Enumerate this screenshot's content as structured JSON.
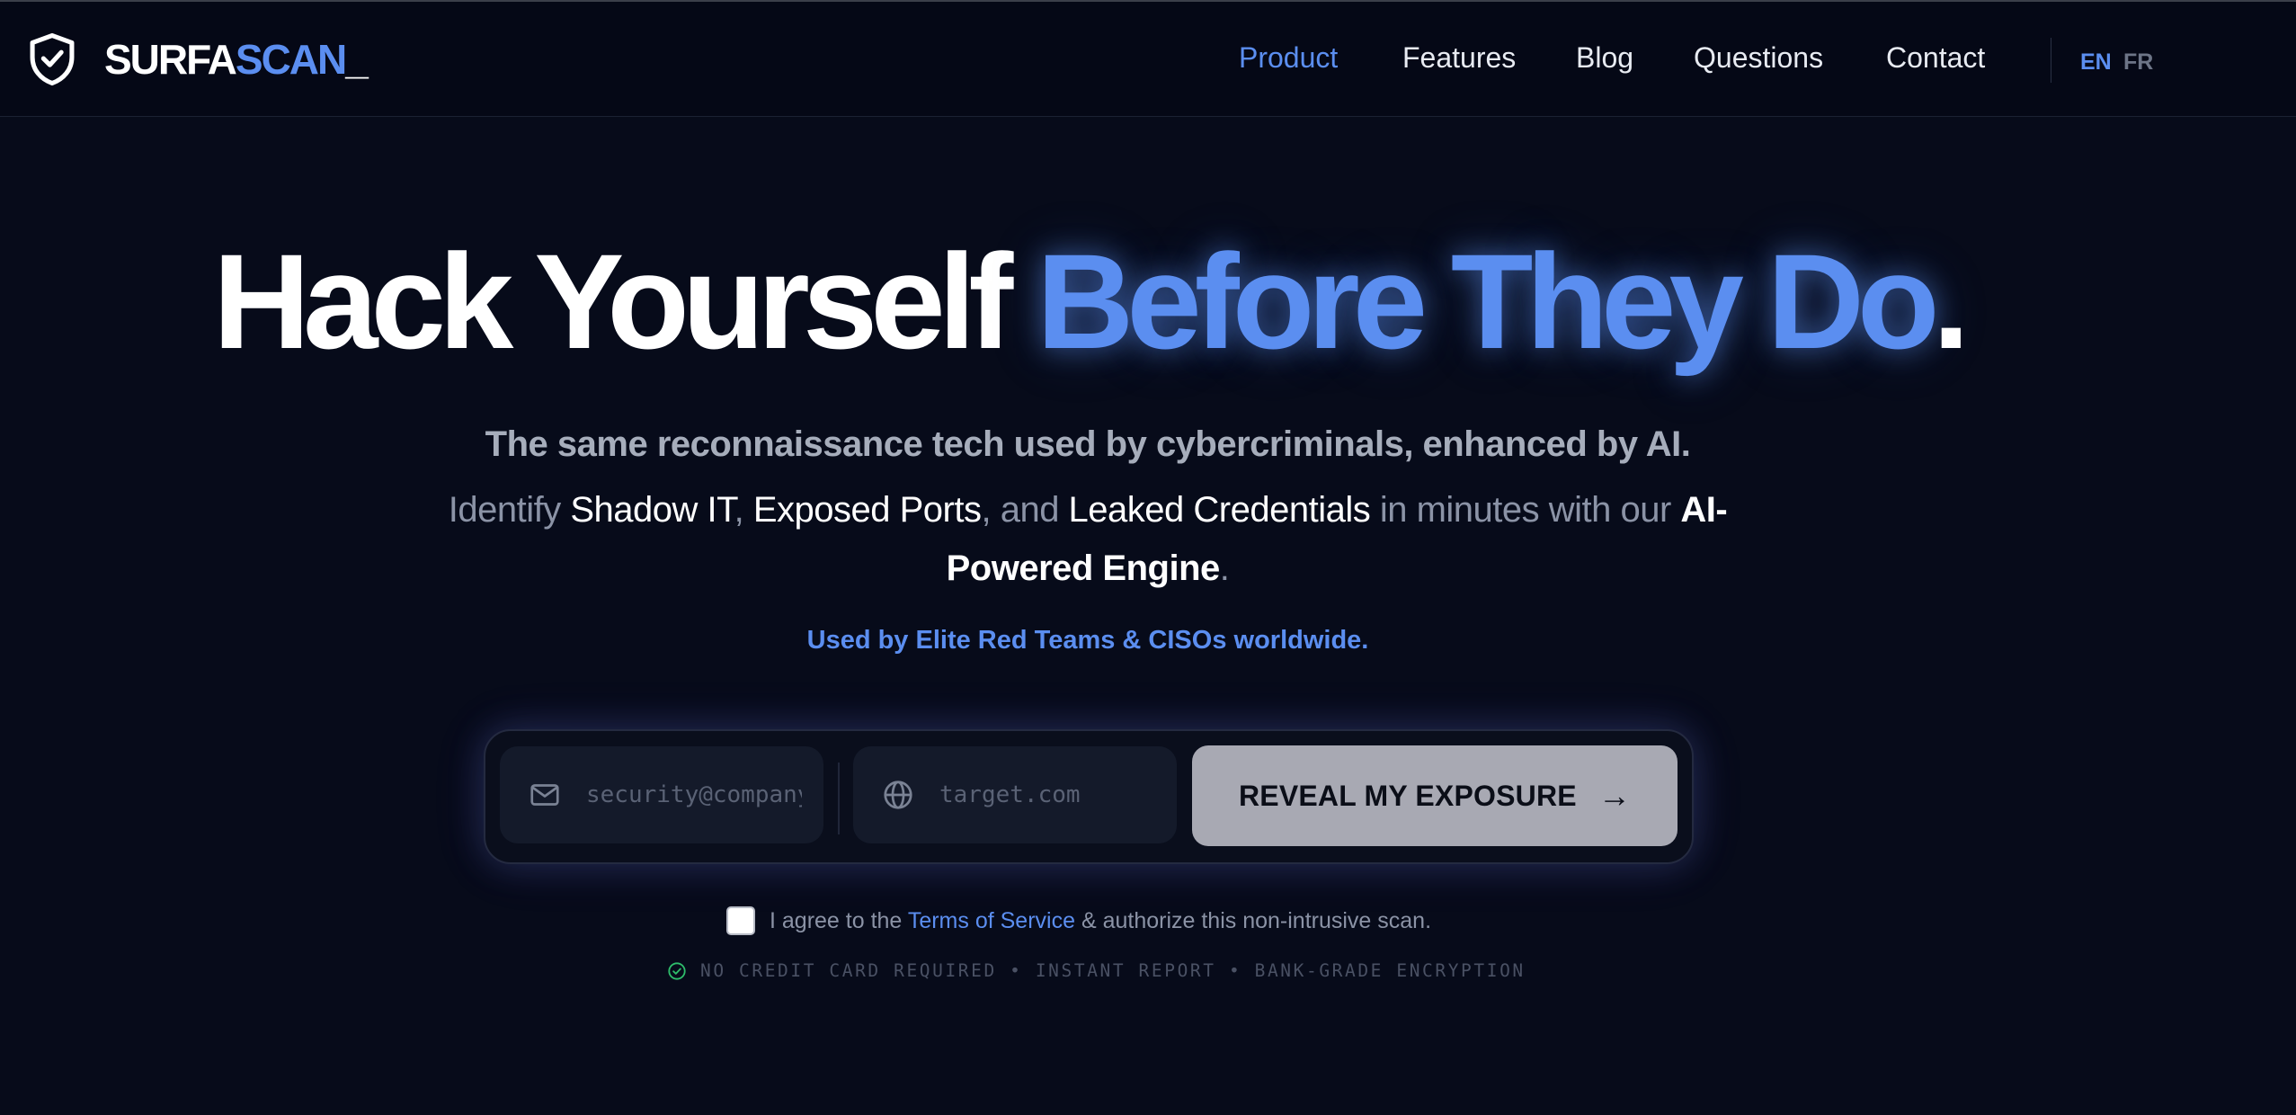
{
  "brand": {
    "part1": "SURFA",
    "part2": "SCAN",
    "part3": "_",
    "icon": "shield-check-icon",
    "accent_color": "#5b8ef0"
  },
  "nav": {
    "items": [
      {
        "label": "Product",
        "active": true
      },
      {
        "label": "Features",
        "active": false
      },
      {
        "label": "Blog",
        "active": false
      },
      {
        "label": "Questions",
        "active": false
      },
      {
        "label": "Contact",
        "active": false
      }
    ],
    "languages": [
      {
        "label": "EN",
        "active": true
      },
      {
        "label": "FR",
        "active": false
      }
    ]
  },
  "hero": {
    "title_white": "Hack Yourself ",
    "title_accent": "Before They Do",
    "title_dot": ".",
    "subtitle": "The same reconnaissance tech used by cybercriminals, enhanced by AI.",
    "desc": {
      "p1": "Identify ",
      "h1": "Shadow IT",
      "p2": ", ",
      "h2": "Exposed Ports",
      "p3": ", and ",
      "h3": "Leaked Credentials",
      "p4": " in minutes with our ",
      "h4": "AI-Powered Engine",
      "p5": "."
    },
    "trust_line": "Used by Elite Red Teams & CISOs worldwide."
  },
  "form": {
    "email_placeholder": "security@company.com",
    "email_icon": "mail-icon",
    "domain_placeholder": "target.com",
    "domain_icon": "globe-icon",
    "submit_label": "REVEAL MY EXPOSURE",
    "submit_arrow": "→"
  },
  "agreement": {
    "checked": false,
    "text_before": "I agree to the ",
    "link_text": "Terms of Service",
    "text_after": " & authorize this non-intrusive scan."
  },
  "badges": {
    "icon": "check-circle-icon",
    "text": "NO CREDIT CARD REQUIRED • INSTANT REPORT • BANK-GRADE ENCRYPTION"
  }
}
